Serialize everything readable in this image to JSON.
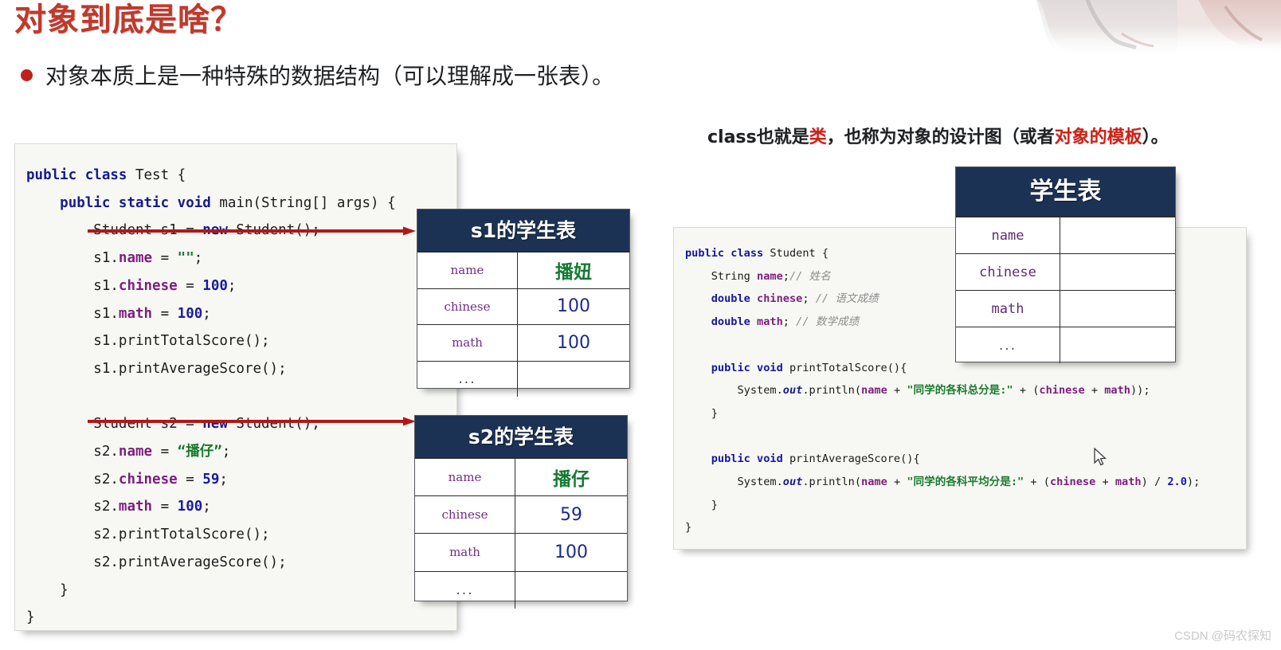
{
  "slide": {
    "title": "对象到底是啥？",
    "bullet": "对象本质上是一种特殊的数据结构（可以理解成一张表）。",
    "right_heading_parts": {
      "p1": "class也就是",
      "p2_hl": "类",
      "p3": "，也称为对象的设计图（或者",
      "p4_hl": "对象的模板",
      "p5": "）。"
    },
    "watermark": "CSDN @码农探知"
  },
  "colors": {
    "title_red": "#c0392b",
    "bullet_red": "#c0201b",
    "highlight_red": "#cf2017",
    "table_header_navy": "#1c3254",
    "code_bg": "#f7f8f4",
    "keyword_blue": "#151b8d",
    "field_purple": "#7d1f7d",
    "string_green": "#1a7a2e",
    "number_blue": "#1b1b9c",
    "comment_gray": "#8d8d8d"
  },
  "code_left": {
    "lines": [
      "public class Test {",
      "    public static void main(String[] args) {",
      "        Student s1 = new Student();",
      "        s1.name = \"\";",
      "        s1.chinese = 100;",
      "        s1.math = 100;",
      "        s1.printTotalScore();",
      "        s1.printAverageScore();",
      "",
      "        Student s2 = new Student();",
      "        s2.name = “播仔”;",
      "        s2.chinese = 59;",
      "        s2.math = 100;",
      "        s2.printTotalScore();",
      "        s2.printAverageScore();",
      "    }",
      "}"
    ]
  },
  "code_right": {
    "lines": [
      "public class Student {",
      "    String name;// 姓名",
      "    double chinese; // 语文成绩",
      "    double math; // 数学成绩",
      "",
      "    public void printTotalScore(){",
      "        System.out.println(name + \"同学的各科总分是:\" + (chinese + math));",
      "    }",
      "",
      "    public void printAverageScore(){",
      "        System.out.println(name + \"同学的各科平均分是:\" + (chinese + math) / 2.0);",
      "    }",
      "}"
    ]
  },
  "tables": {
    "s1": {
      "title": "s1的学生表",
      "rows": [
        {
          "key": "name",
          "value": "播妞",
          "kind": "name"
        },
        {
          "key": "chinese",
          "value": "100",
          "kind": "score"
        },
        {
          "key": "math",
          "value": "100",
          "kind": "score"
        },
        {
          "key": "...",
          "value": "",
          "kind": "dots"
        }
      ]
    },
    "s2": {
      "title": "s2的学生表",
      "rows": [
        {
          "key": "name",
          "value": "播仔",
          "kind": "name"
        },
        {
          "key": "chinese",
          "value": "59",
          "kind": "score"
        },
        {
          "key": "math",
          "value": "100",
          "kind": "score"
        },
        {
          "key": "...",
          "value": "",
          "kind": "dots"
        }
      ]
    },
    "student_class": {
      "title": "学生表",
      "rows": [
        {
          "key": "name",
          "value": ""
        },
        {
          "key": "chinese",
          "value": ""
        },
        {
          "key": "math",
          "value": ""
        },
        {
          "key": "...",
          "value": ""
        }
      ]
    }
  },
  "arrows": [
    {
      "name": "arrow-s1",
      "label": ""
    },
    {
      "name": "arrow-s2",
      "label": ""
    }
  ],
  "icons": {
    "bullet": "bullet-dot-icon",
    "cursor": "mouse-pointer-icon",
    "brush": "watercolor-brush-decoration"
  }
}
